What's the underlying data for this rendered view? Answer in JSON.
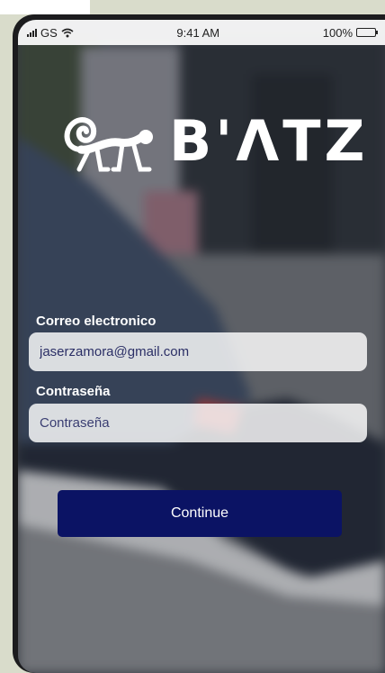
{
  "status_bar": {
    "carrier": "GS",
    "time": "9:41 AM",
    "battery": "100%"
  },
  "logo": {
    "brand": "B'ΛTZ",
    "mark_icon": "monkey-icon"
  },
  "form": {
    "email_label": "Correo electronico",
    "email_value": "jaserzamora@gmail.com",
    "password_label": "Contraseña",
    "password_placeholder": "Contraseña",
    "continue_label": "Continue"
  },
  "colors": {
    "button": "#0b1364",
    "field_text": "#2b2f66"
  }
}
